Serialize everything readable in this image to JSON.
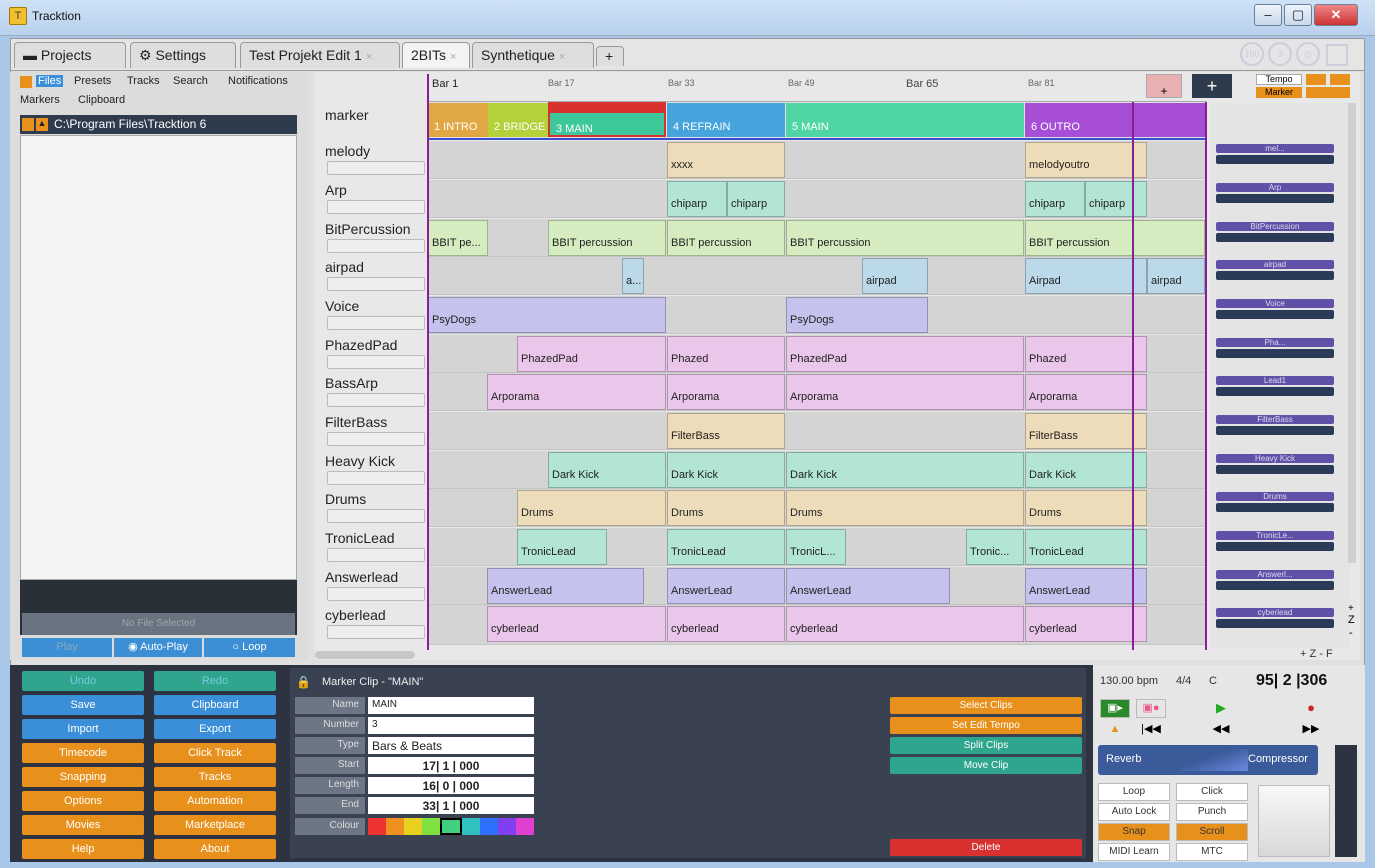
{
  "window": {
    "title": "Tracktion",
    "min_label": "–",
    "max_label": "▢",
    "close_label": "✕"
  },
  "tabs": {
    "projects": "Projects",
    "settings": "Settings",
    "items": [
      {
        "label": "Test Projekt Edit 1"
      },
      {
        "label": "2BITs"
      },
      {
        "label": "Synthetique"
      }
    ],
    "close_glyph": "×",
    "add_label": "+",
    "circle_labels": [
      "100",
      "3"
    ]
  },
  "browser": {
    "tabs": [
      "Files",
      "Presets",
      "Tracks",
      "Search",
      "Notifications",
      "Markers",
      "Clipboard"
    ],
    "path": "C:\\Program Files\\Tracktion 6",
    "no_file": "No File Selected",
    "play": "Play",
    "autoplay": "Auto-Play",
    "loop": "Loop"
  },
  "ruler": {
    "bars": [
      "Bar 1",
      "Bar 17",
      "Bar 33",
      "Bar 49",
      "Bar 65",
      "Bar 81"
    ],
    "tempo": "Tempo",
    "marker": "Marker",
    "add": "+"
  },
  "marker_track": {
    "name": "marker",
    "clips": [
      {
        "label": "1 INTRO",
        "color": "#e0a845"
      },
      {
        "label": "2 BRIDGE",
        "color": "#b5d13a"
      },
      {
        "label": "3 MAIN",
        "color": "#3ec79a"
      },
      {
        "label": "4 REFRAIN",
        "color": "#45a4dc"
      },
      {
        "label": "5 MAIN",
        "color": "#4fd6a4"
      },
      {
        "label": "6 OUTRO",
        "color": "#a64fd6"
      }
    ]
  },
  "tracks": [
    {
      "name": "melody",
      "plugin": "mel..."
    },
    {
      "name": "Arp",
      "plugin": "Arp"
    },
    {
      "name": "BitPercussion",
      "plugin": "BitPercussion"
    },
    {
      "name": "airpad",
      "plugin": "airpad"
    },
    {
      "name": "Voice",
      "plugin": "Voice"
    },
    {
      "name": "PhazedPad",
      "plugin": "Pha..."
    },
    {
      "name": "BassArp",
      "plugin": "Lead1"
    },
    {
      "name": "FilterBass",
      "plugin": "FilterBass"
    },
    {
      "name": "Heavy Kick",
      "plugin": "Heavy Kick"
    },
    {
      "name": "Drums",
      "plugin": "Drums"
    },
    {
      "name": "TronicLead",
      "plugin": "TronicLe..."
    },
    {
      "name": "Answerlead",
      "plugin": "Answerl..."
    },
    {
      "name": "cyberlead",
      "plugin": "cyberlead"
    }
  ],
  "clips": {
    "melody": [
      "xxxx",
      "melodyoutro"
    ],
    "arp": [
      "chiparp",
      "chiparp",
      "chiparp",
      "chiparp"
    ],
    "bitperc": [
      "BBIT pe...",
      "BBIT percussion",
      "BBIT percussion",
      "BBIT percussion",
      "BBIT percussion"
    ],
    "airpad": [
      "a...",
      "airpad",
      "Airpad",
      "airpad"
    ],
    "voice": [
      "PsyDogs",
      "PsyDogs"
    ],
    "phazed": [
      "PhazedPad",
      "Phazed",
      "PhazedPad",
      "Phazed"
    ],
    "bassarp": [
      "Arporama",
      "Arporama",
      "Arporama",
      "Arporama"
    ],
    "filterbass": [
      "FilterBass",
      "FilterBass"
    ],
    "kick": [
      "Dark Kick",
      "Dark Kick",
      "Dark Kick",
      "Dark Kick"
    ],
    "drums": [
      "Drums",
      "Drums",
      "Drums",
      "Drums"
    ],
    "tronic": [
      "TronicLead",
      "TronicLead",
      "TronicL...",
      "Tronic...",
      "TronicLead"
    ],
    "answer": [
      "AnswerLead",
      "AnswerLead",
      "AnswerLead",
      "AnswerLead"
    ],
    "cyber": [
      "cyberlead",
      "cyberlead",
      "cyberlead",
      "cyberlead"
    ]
  },
  "zoom": {
    "z": "Z",
    "plus": "+",
    "minus": "-",
    "bottom": "+ Z - F"
  },
  "left_buttons": [
    [
      "Undo",
      "Redo"
    ],
    [
      "Save",
      "Clipboard"
    ],
    [
      "Import",
      "Export"
    ],
    [
      "Timecode",
      "Click Track"
    ],
    [
      "Snapping",
      "Tracks"
    ],
    [
      "Options",
      "Automation"
    ],
    [
      "Movies",
      "Marketplace"
    ],
    [
      "Help",
      "About"
    ]
  ],
  "properties": {
    "title": "Marker Clip - \"MAIN\"",
    "rows": [
      {
        "label": "Name",
        "value": "MAIN"
      },
      {
        "label": "Number",
        "value": "3"
      },
      {
        "label": "Type",
        "value": "Bars & Beats"
      },
      {
        "label": "Start",
        "value": "17| 1 | 000"
      },
      {
        "label": "Length",
        "value": "16| 0 | 000"
      },
      {
        "label": "End",
        "value": "33| 1 | 000"
      }
    ],
    "colour_label": "Colour",
    "swatches": [
      "#ee3333",
      "#f09020",
      "#e8d020",
      "#80e040",
      "#40d080",
      "#30c0c0",
      "#3070ff",
      "#8040f0",
      "#e040d0"
    ]
  },
  "actions": [
    "Select Clips",
    "Set Edit Tempo",
    "Split Clips",
    "Move Clip",
    "Delete"
  ],
  "transport": {
    "bpm": "130.00 bpm",
    "sig": "4/4",
    "key": "C",
    "position": "95| 2 |306",
    "plugins": [
      "Reverb",
      "Compressor"
    ],
    "buttons": [
      [
        "Loop",
        "Click"
      ],
      [
        "Auto Lock",
        "Punch"
      ],
      [
        "Snap",
        "Scroll"
      ],
      [
        "MIDI Learn",
        "MTC"
      ]
    ]
  }
}
